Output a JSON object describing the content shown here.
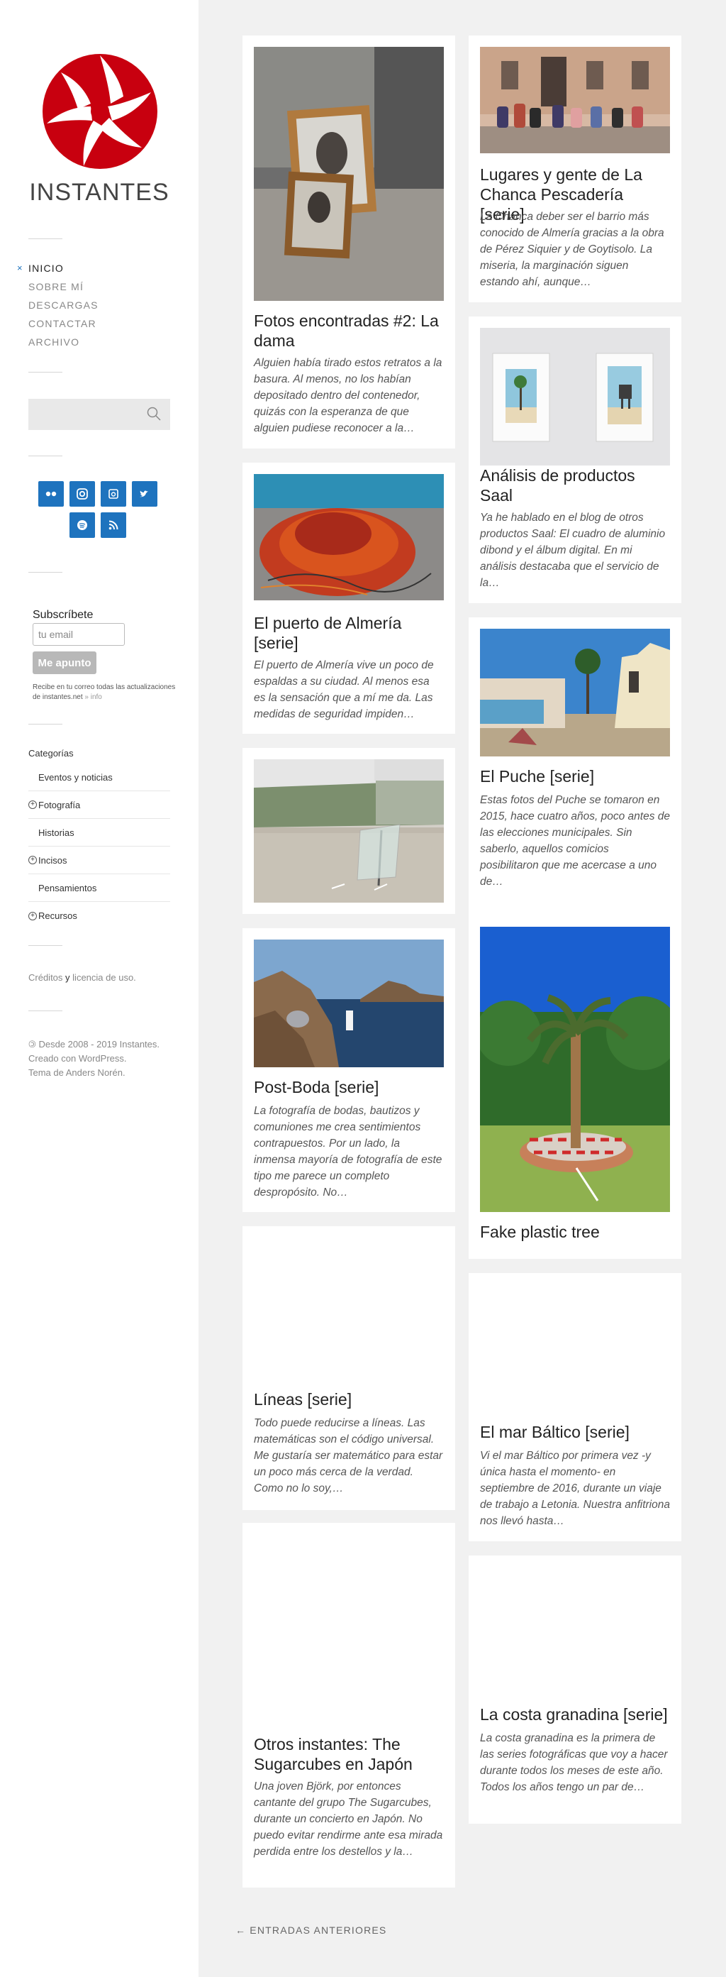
{
  "site": {
    "title": "INSTANTES"
  },
  "nav": [
    {
      "label": "INICIO",
      "active": true
    },
    {
      "label": "SOBRE MÍ"
    },
    {
      "label": "DESCARGAS"
    },
    {
      "label": "CONTACTAR"
    },
    {
      "label": "ARCHIVO"
    }
  ],
  "nav_active_marker": "×",
  "search": {
    "placeholder": ""
  },
  "social": [
    "flickr-icon",
    "instagram-icon",
    "500px-icon",
    "twitter-icon",
    "spotify-icon",
    "rss-icon"
  ],
  "subscribe": {
    "title": "Subscríbete",
    "placeholder": "tu email",
    "button": "Me apunto",
    "note": "Recibe en tu correo todas las actualizaciones de instantes.net",
    "info": "» info"
  },
  "categories": {
    "title": "Categorías",
    "items": [
      {
        "label": "Eventos y noticias",
        "expandable": false
      },
      {
        "label": "Fotografía",
        "expandable": true
      },
      {
        "label": "Historias",
        "expandable": false
      },
      {
        "label": "Incisos",
        "expandable": true
      },
      {
        "label": "Pensamientos",
        "expandable": false
      },
      {
        "label": "Recursos",
        "expandable": true
      }
    ]
  },
  "credits": {
    "a": "Créditos",
    "b": "y",
    "c": "licencia de uso."
  },
  "footer": {
    "line1": "Desde 2008 - 2019 Instantes.",
    "line2": "Creado con WordPress.",
    "line3": "Tema de Anders Norén."
  },
  "posts": [
    {
      "title": "Fotos encontradas #2: La dama",
      "excerpt": "Alguien había tirado estos retratos a la basura. Al menos, no los habían depositado dentro del contenedor, quizás con la esperanza de que alguien pudiese reconocer a la…"
    },
    {
      "title": "Lugares y gente de La Chanca Pescadería [serie]",
      "excerpt": "La Chanca deber ser el barrio más conocido de Almería gracias a la obra de Pérez Siquier y de Goytisolo. La miseria, la marginación siguen estando ahí, aunque…"
    },
    {
      "title": "Análisis de productos Saal",
      "excerpt": "Ya he hablado en el blog de otros productos Saal: El cuadro de aluminio dibond y el álbum digital. En mi análisis destacaba que el servicio de la…"
    },
    {
      "title": "El puerto de Almería [serie]",
      "excerpt": "El puerto de Almería vive un poco de espaldas a su ciudad. Al menos esa es la sensación que a mí me da. Las medidas de seguridad impiden…"
    },
    {
      "title": "",
      "excerpt": ""
    },
    {
      "title": "El Puche [serie]",
      "excerpt": "Estas fotos del Puche se tomaron en 2015, hace cuatro años, poco antes de las elecciones municipales. Sin saberlo, aquellos comicios posibilitaron que me acercase a uno de…"
    },
    {
      "title": "Post-Boda [serie]",
      "excerpt": "La fotografía de bodas, bautizos y comuniones me crea sentimientos contrapuestos. Por un lado,  la inmensa mayoría de fotografía de este tipo me parece un completo despropósito. No…"
    },
    {
      "title": "Fake plastic tree",
      "excerpt": ""
    },
    {
      "title": "Líneas [serie]",
      "excerpt": "Todo puede reducirse a líneas. Las matemáticas son el código universal. Me gustaría ser matemático para estar un poco más cerca de la verdad. Como no lo soy,…"
    },
    {
      "title": "El mar Báltico [serie]",
      "excerpt": "Vi el mar Báltico por primera vez -y única hasta el momento- en septiembre de 2016, durante un viaje de trabajo a Letonia. Nuestra anfitriona nos llevó hasta…"
    },
    {
      "title": "Otros instantes: The Sugarcubes en Japón",
      "excerpt": "Una joven Björk, por entonces cantante del grupo  The Sugarcubes, durante un concierto en Japón. No puedo evitar rendirme ante esa mirada perdida entre los destellos y la…"
    },
    {
      "title": "La costa granadina [serie]",
      "excerpt": "La costa granadina es la primera de las series fotográficas que voy a hacer durante todos los meses de este año. Todos los años tengo un par de…"
    }
  ],
  "pagination": {
    "older": "← ENTRADAS ANTERIORES"
  },
  "colors": {
    "accent": "#1e73be",
    "logo": "#c8000f",
    "background": "#f1f1f1"
  }
}
